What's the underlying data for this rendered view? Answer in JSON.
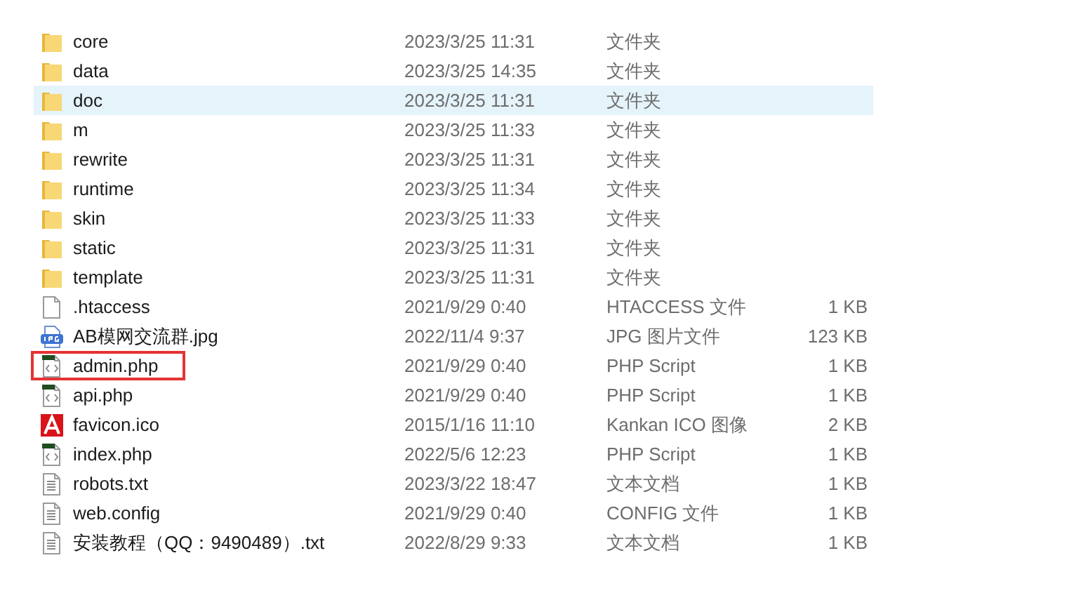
{
  "files": [
    {
      "name": "core",
      "modified": "2023/3/25 11:31",
      "type": "文件夹",
      "kind": "folder",
      "selected": false,
      "marked": false
    },
    {
      "name": "data",
      "modified": "2023/3/25 14:35",
      "type": "文件夹",
      "kind": "folder",
      "selected": false,
      "marked": false
    },
    {
      "name": "doc",
      "modified": "2023/3/25 11:31",
      "type": "文件夹",
      "kind": "folder",
      "selected": true,
      "marked": false
    },
    {
      "name": "m",
      "modified": "2023/3/25 11:33",
      "type": "文件夹",
      "kind": "folder",
      "selected": false,
      "marked": false
    },
    {
      "name": "rewrite",
      "modified": "2023/3/25 11:31",
      "type": "文件夹",
      "kind": "folder",
      "selected": false,
      "marked": false
    },
    {
      "name": "runtime",
      "modified": "2023/3/25 11:34",
      "type": "文件夹",
      "kind": "folder",
      "selected": false,
      "marked": false
    },
    {
      "name": "skin",
      "modified": "2023/3/25 11:33",
      "type": "文件夹",
      "kind": "folder",
      "selected": false,
      "marked": false
    },
    {
      "name": "static",
      "modified": "2023/3/25 11:31",
      "type": "文件夹",
      "kind": "folder",
      "selected": false,
      "marked": false
    },
    {
      "name": "template",
      "modified": "2023/3/25 11:31",
      "type": "文件夹",
      "kind": "folder",
      "selected": false,
      "marked": false
    },
    {
      "name": ".htaccess",
      "modified": "2021/9/29 0:40",
      "type": "HTACCESS 文件",
      "size": "1 KB",
      "kind": "blank",
      "selected": false,
      "marked": false
    },
    {
      "name": "AB模网交流群.jpg",
      "modified": "2022/11/4 9:37",
      "type": "JPG 图片文件",
      "size": "123 KB",
      "kind": "jpg",
      "selected": false,
      "marked": false
    },
    {
      "name": "admin.php",
      "modified": "2021/9/29 0:40",
      "type": "PHP Script",
      "size": "1 KB",
      "kind": "php",
      "selected": false,
      "marked": true
    },
    {
      "name": "api.php",
      "modified": "2021/9/29 0:40",
      "type": "PHP Script",
      "size": "1 KB",
      "kind": "php",
      "selected": false,
      "marked": false
    },
    {
      "name": "favicon.ico",
      "modified": "2015/1/16 11:10",
      "type": "Kankan ICO 图像",
      "size": "2 KB",
      "kind": "ico",
      "selected": false,
      "marked": false
    },
    {
      "name": "index.php",
      "modified": "2022/5/6 12:23",
      "type": "PHP Script",
      "size": "1 KB",
      "kind": "php",
      "selected": false,
      "marked": false
    },
    {
      "name": "robots.txt",
      "modified": "2023/3/22 18:47",
      "type": "文本文档",
      "size": "1 KB",
      "kind": "text",
      "selected": false,
      "marked": false
    },
    {
      "name": "web.config",
      "modified": "2021/9/29 0:40",
      "type": "CONFIG 文件",
      "size": "1 KB",
      "kind": "text",
      "selected": false,
      "marked": false
    },
    {
      "name": "安装教程（QQ：9490489）.txt",
      "modified": "2022/8/29 9:33",
      "type": "文本文档",
      "size": "1 KB",
      "kind": "text",
      "selected": false,
      "marked": false
    }
  ]
}
